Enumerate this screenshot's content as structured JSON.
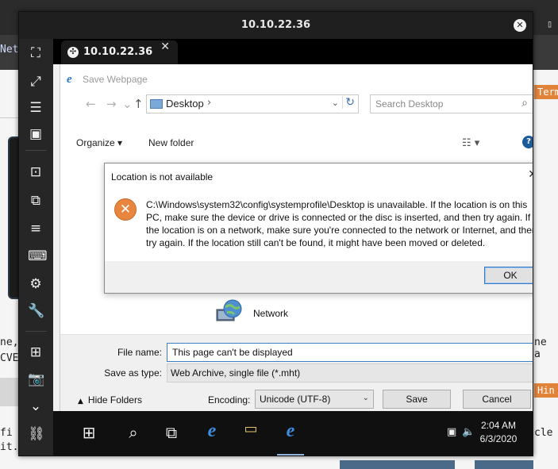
{
  "viewer": {
    "title": "10.10.22.36",
    "tab_label": "10.10.22.36",
    "tab_close": "✕",
    "close_glyph": "✕",
    "toolbar_icons": [
      "fullscreen-icon",
      "resize-icon",
      "menu-icon",
      "window-icon",
      "screenshot-region-icon",
      "scale-icon",
      "list-icon",
      "keyboard-icon",
      "settings-icon",
      "wrench-icon",
      "add-icon",
      "camera-icon",
      "chevron-down-icon",
      "disconnect-icon"
    ]
  },
  "background": {
    "net_fragment": "Netl",
    "left_text_1": "ne,",
    "left_text_2": "CVE",
    "left_text_3": "fi",
    "left_text_4": "it.",
    "right_btn_1": "Term",
    "right_text_1": "ne a",
    "right_btn_2": "Hin",
    "right_text_2": "cle"
  },
  "save_dialog": {
    "title": "Save Webpage",
    "address_path": "Desktop",
    "search_placeholder": "Search Desktop",
    "organize_label": "Organize ▾",
    "new_folder_label": "New folder",
    "network_item_label": "Network",
    "file_name_label": "File name:",
    "file_name_value": "This page can't be displayed",
    "save_as_type_label": "Save as type:",
    "save_as_type_value": "Web Archive, single file (*.mht)",
    "hide_folders_label": "Hide Folders",
    "encoding_label": "Encoding:",
    "encoding_value": "Unicode (UTF-8)",
    "save_button": "Save",
    "cancel_button": "Cancel"
  },
  "error_dialog": {
    "title": "Location is not available",
    "message": "C:\\Windows\\system32\\config\\systemprofile\\Desktop is unavailable. If the location is on this PC, make sure the device or drive is connected or the disc is inserted, and then try again. If the location is on a network, make sure you're connected to the network or Internet, and then try again. If the location still can't be found, it might have been moved or deleted.",
    "ok_button": "OK"
  },
  "taskbar": {
    "time": "2:04 AM",
    "date": "6/3/2020"
  },
  "colors": {
    "accent_orange": "#e2833a",
    "error_icon": "#e8863f",
    "focus_blue": "#2f79c6"
  }
}
